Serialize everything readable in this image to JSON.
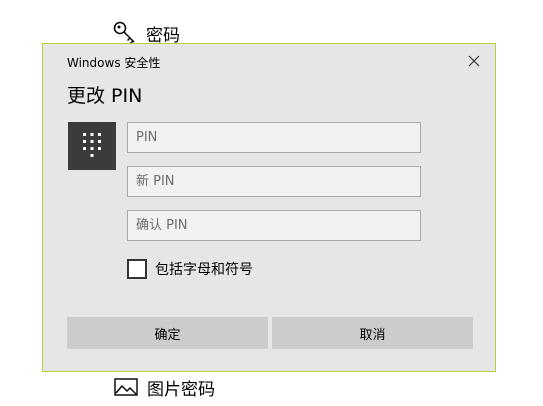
{
  "background": {
    "password_label": "密码",
    "picture_password_label": "图片密码"
  },
  "dialog": {
    "title": "Windows 安全性",
    "heading": "更改 PIN",
    "fields": {
      "pin_placeholder": "PIN",
      "new_pin_placeholder": "新 PIN",
      "confirm_pin_placeholder": "确认 PIN"
    },
    "checkbox_label": "包括字母和符号",
    "checkbox_checked": false,
    "ok_label": "确定",
    "cancel_label": "取消",
    "icons": {
      "close": "close-icon",
      "keypad": "keypad-icon",
      "key": "key-icon",
      "picture": "picture-icon"
    }
  },
  "colors": {
    "dialog_bg": "#e6e6e6",
    "dialog_border": "#b6cf3a",
    "keypad_tile": "#3b3b3b",
    "button_bg": "#cccccc"
  }
}
